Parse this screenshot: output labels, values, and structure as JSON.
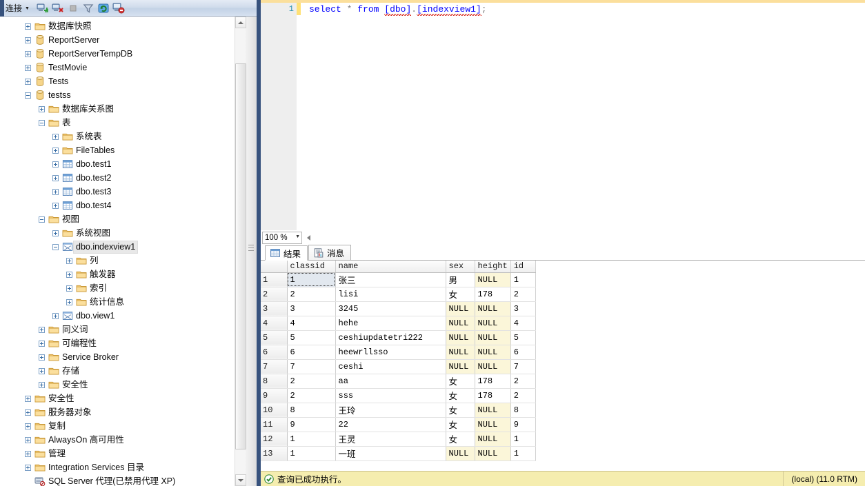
{
  "explorer": {
    "toolbar": {
      "connect_label": "连接",
      "buttons": [
        {
          "name": "connect-object-explorer-icon",
          "title": "连接"
        },
        {
          "name": "disconnect-object-explorer-icon",
          "title": "断开连接"
        },
        {
          "name": "stop-icon",
          "title": "停止"
        },
        {
          "name": "filter-icon",
          "title": "筛选"
        },
        {
          "name": "refresh-icon",
          "title": "刷新"
        },
        {
          "name": "disconnect-all-icon",
          "title": "全部断开连接"
        }
      ]
    },
    "tree": [
      {
        "label": "数据库快照",
        "indent": 1,
        "icon": "folder",
        "state": "plus"
      },
      {
        "label": "ReportServer",
        "indent": 1,
        "icon": "database",
        "state": "plus"
      },
      {
        "label": "ReportServerTempDB",
        "indent": 1,
        "icon": "database",
        "state": "plus"
      },
      {
        "label": "TestMovie",
        "indent": 1,
        "icon": "database",
        "state": "plus"
      },
      {
        "label": "Tests",
        "indent": 1,
        "icon": "database",
        "state": "plus"
      },
      {
        "label": "testss",
        "indent": 1,
        "icon": "database",
        "state": "minus"
      },
      {
        "label": "数据库关系图",
        "indent": 2,
        "icon": "folder",
        "state": "plus"
      },
      {
        "label": "表",
        "indent": 2,
        "icon": "folder",
        "state": "minus"
      },
      {
        "label": "系统表",
        "indent": 3,
        "icon": "folder",
        "state": "plus"
      },
      {
        "label": "FileTables",
        "indent": 3,
        "icon": "folder",
        "state": "plus"
      },
      {
        "label": "dbo.test1",
        "indent": 3,
        "icon": "table",
        "state": "plus"
      },
      {
        "label": "dbo.test2",
        "indent": 3,
        "icon": "table",
        "state": "plus"
      },
      {
        "label": "dbo.test3",
        "indent": 3,
        "icon": "table",
        "state": "plus"
      },
      {
        "label": "dbo.test4",
        "indent": 3,
        "icon": "table",
        "state": "plus"
      },
      {
        "label": "视图",
        "indent": 2,
        "icon": "folder",
        "state": "minus"
      },
      {
        "label": "系统视图",
        "indent": 3,
        "icon": "folder",
        "state": "plus"
      },
      {
        "label": "dbo.indexview1",
        "indent": 3,
        "icon": "view",
        "state": "minus",
        "selected": true
      },
      {
        "label": "列",
        "indent": 4,
        "icon": "folder",
        "state": "plus"
      },
      {
        "label": "触发器",
        "indent": 4,
        "icon": "folder",
        "state": "plus"
      },
      {
        "label": "索引",
        "indent": 4,
        "icon": "folder",
        "state": "plus"
      },
      {
        "label": "统计信息",
        "indent": 4,
        "icon": "folder",
        "state": "plus"
      },
      {
        "label": "dbo.view1",
        "indent": 3,
        "icon": "view",
        "state": "plus"
      },
      {
        "label": "同义词",
        "indent": 2,
        "icon": "folder",
        "state": "plus"
      },
      {
        "label": "可编程性",
        "indent": 2,
        "icon": "folder",
        "state": "plus"
      },
      {
        "label": "Service Broker",
        "indent": 2,
        "icon": "folder",
        "state": "plus"
      },
      {
        "label": "存储",
        "indent": 2,
        "icon": "folder",
        "state": "plus"
      },
      {
        "label": "安全性",
        "indent": 2,
        "icon": "folder",
        "state": "plus"
      },
      {
        "label": "安全性",
        "indent": 1,
        "icon": "folder",
        "state": "plus"
      },
      {
        "label": "服务器对象",
        "indent": 1,
        "icon": "folder",
        "state": "plus"
      },
      {
        "label": "复制",
        "indent": 1,
        "icon": "folder",
        "state": "plus"
      },
      {
        "label": "AlwaysOn 高可用性",
        "indent": 1,
        "icon": "folder",
        "state": "plus"
      },
      {
        "label": "管理",
        "indent": 1,
        "icon": "folder",
        "state": "plus"
      },
      {
        "label": "Integration Services 目录",
        "indent": 1,
        "icon": "folder",
        "state": "plus"
      },
      {
        "label": "SQL Server 代理(已禁用代理 XP)",
        "indent": 1,
        "icon": "agent",
        "state": "none"
      }
    ]
  },
  "editor": {
    "line_number": "1",
    "tokens": {
      "select": "select",
      "star": "*",
      "from": "from",
      "schema": "[dbo]",
      "dot": ".",
      "object": "[indexview1]",
      "semicolon": ";"
    },
    "full_text": "select * from [dbo].[indexview1];"
  },
  "zoombar": {
    "zoom_value": "100 %"
  },
  "results": {
    "tabs": [
      {
        "label": "结果",
        "icon": "grid-icon",
        "active": true
      },
      {
        "label": "消息",
        "icon": "message-icon",
        "active": false
      }
    ],
    "columns": [
      "classid",
      "name",
      "sex",
      "height",
      "id"
    ],
    "rows": [
      {
        "n": "1",
        "classid": "1",
        "name": "张三",
        "sex": "男",
        "height": "NULL",
        "id": "1"
      },
      {
        "n": "2",
        "classid": "2",
        "name": "lisi",
        "sex": "女",
        "height": "178",
        "id": "2"
      },
      {
        "n": "3",
        "classid": "3",
        "name": "3245",
        "sex": "NULL",
        "height": "NULL",
        "id": "3"
      },
      {
        "n": "4",
        "classid": "4",
        "name": "hehe",
        "sex": "NULL",
        "height": "NULL",
        "id": "4"
      },
      {
        "n": "5",
        "classid": "5",
        "name": "ceshiupdatetri222",
        "sex": "NULL",
        "height": "NULL",
        "id": "5"
      },
      {
        "n": "6",
        "classid": "6",
        "name": "heewrllsso",
        "sex": "NULL",
        "height": "NULL",
        "id": "6"
      },
      {
        "n": "7",
        "classid": "7",
        "name": "ceshi",
        "sex": "NULL",
        "height": "NULL",
        "id": "7"
      },
      {
        "n": "8",
        "classid": "2",
        "name": "aa",
        "sex": "女",
        "height": "178",
        "id": "2"
      },
      {
        "n": "9",
        "classid": "2",
        "name": "sss",
        "sex": "女",
        "height": "178",
        "id": "2"
      },
      {
        "n": "10",
        "classid": "8",
        "name": "王玲",
        "sex": "女",
        "height": "NULL",
        "id": "8"
      },
      {
        "n": "11",
        "classid": "9",
        "name": "22",
        "sex": "女",
        "height": "NULL",
        "id": "9"
      },
      {
        "n": "12",
        "classid": "1",
        "name": "王灵",
        "sex": "女",
        "height": "NULL",
        "id": "1"
      },
      {
        "n": "13",
        "classid": "1",
        "name": "一班",
        "sex": "NULL",
        "height": "NULL",
        "id": "1"
      }
    ]
  },
  "statusbar": {
    "message": "查询已成功执行。",
    "server": "(local) (11.0 RTM)"
  },
  "colors": {
    "navy_frame": "#37527d",
    "status_bg": "#f5edaf",
    "null_cell": "#fbf6d9",
    "keyword": "#0000ff",
    "accent_yellow": "#fbdf9c"
  }
}
